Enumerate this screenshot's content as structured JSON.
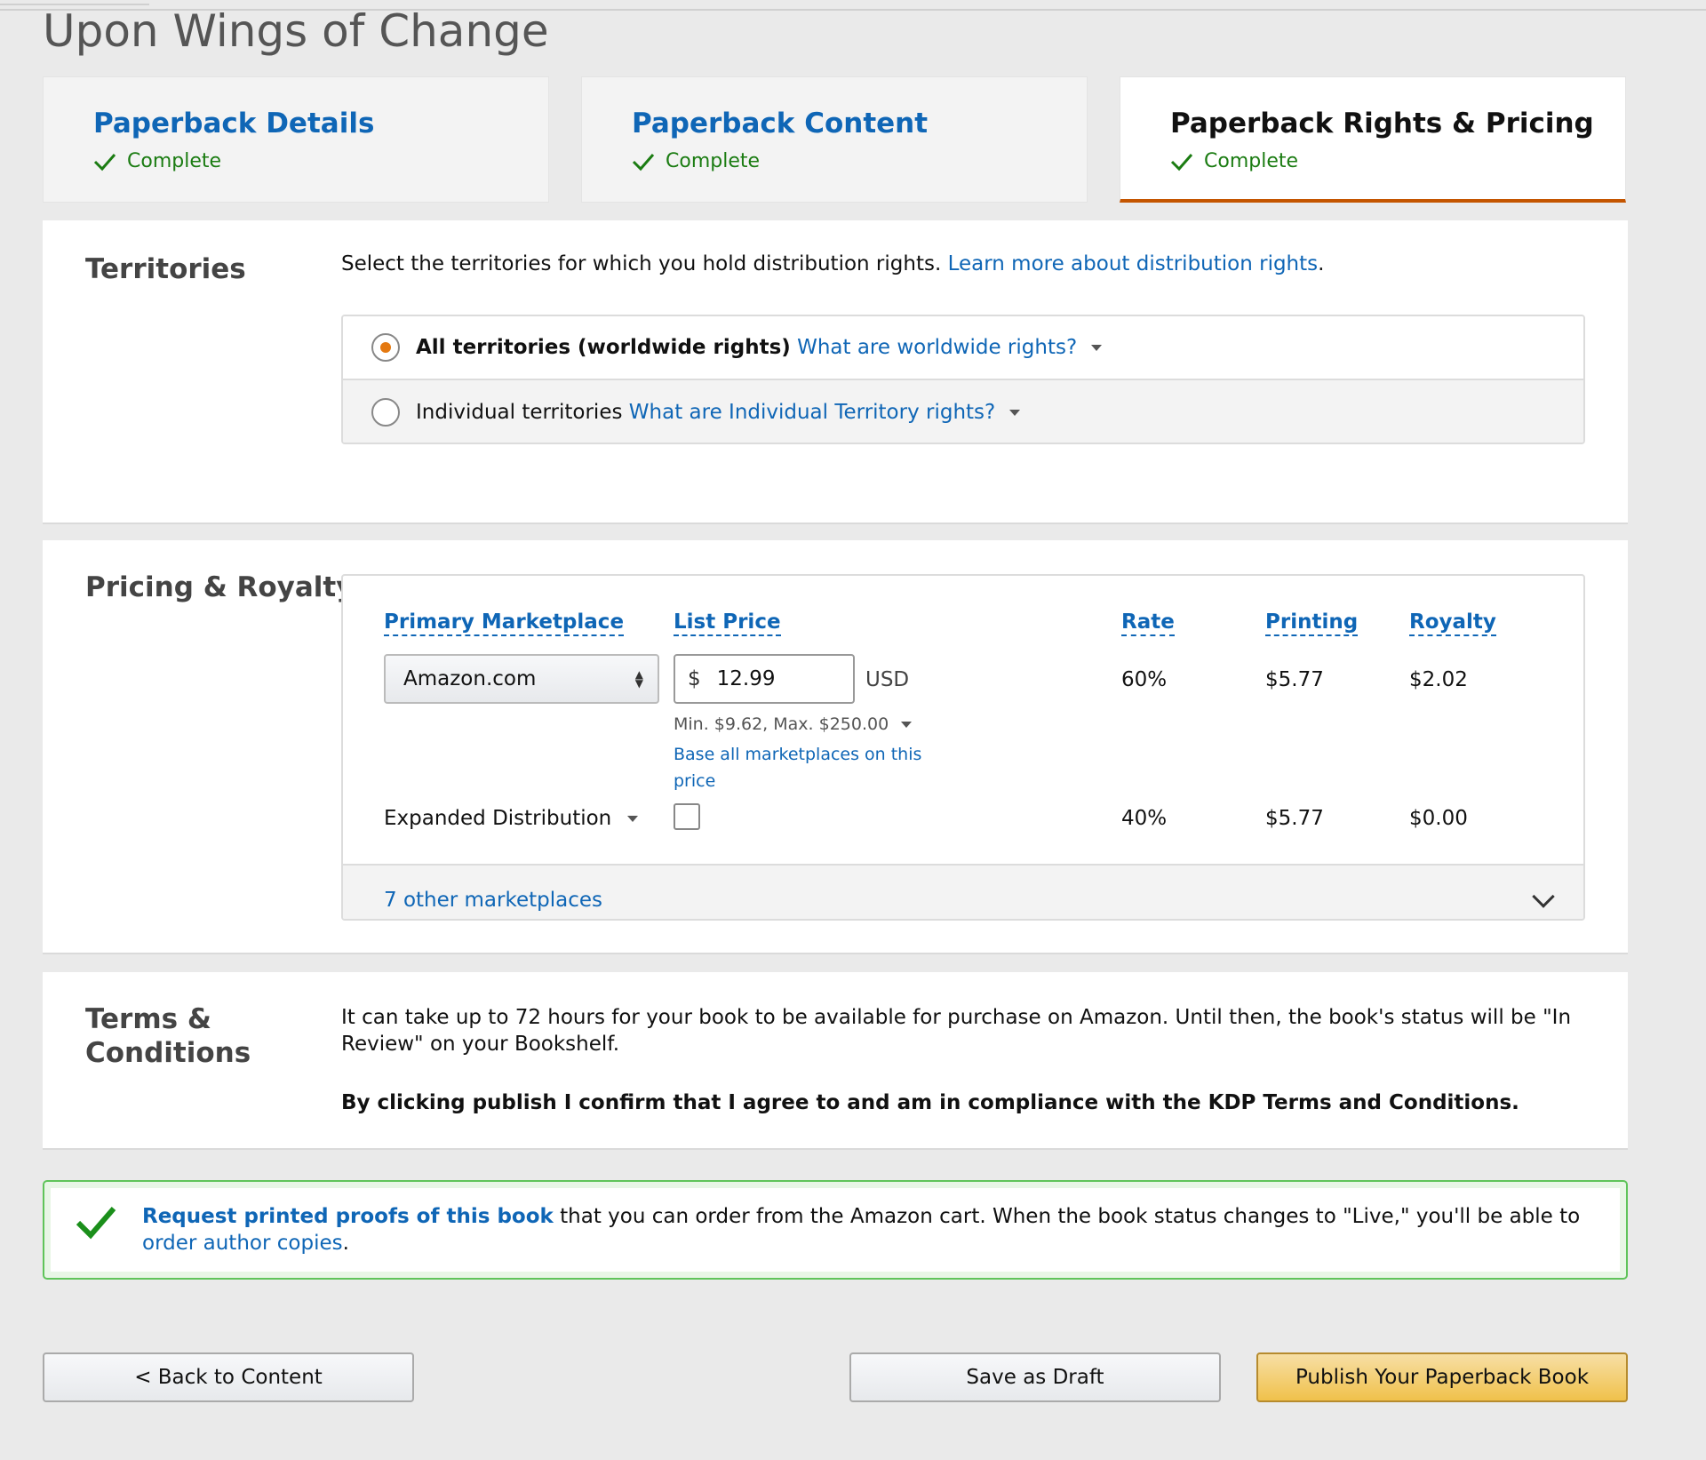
{
  "page": {
    "title": "Upon Wings of Change"
  },
  "steps": [
    {
      "label": "Paperback Details",
      "status": "Complete"
    },
    {
      "label": "Paperback Content",
      "status": "Complete"
    },
    {
      "label": "Paperback Rights & Pricing",
      "status": "Complete"
    }
  ],
  "territories": {
    "heading": "Territories",
    "intro": "Select the territories for which you hold distribution rights.",
    "learn_more": "Learn more about distribution rights",
    "options": [
      {
        "label": "All territories (worldwide rights)",
        "help": "What are worldwide rights?",
        "selected": true
      },
      {
        "label": "Individual territories",
        "help": "What are Individual Territory rights?",
        "selected": false
      }
    ]
  },
  "pricing": {
    "heading": "Pricing & Royalty",
    "columns": {
      "marketplace": "Primary Marketplace",
      "list_price": "List Price",
      "rate": "Rate",
      "printing": "Printing",
      "royalty": "Royalty"
    },
    "marketplace": "Amazon.com",
    "currency_symbol": "$",
    "price": "12.99",
    "currency": "USD",
    "primary": {
      "rate": "60%",
      "printing": "$5.77",
      "royalty": "$2.02"
    },
    "minmax": "Min. $9.62, Max. $250.00",
    "base_link": "Base all marketplaces on this price",
    "expanded": {
      "label": "Expanded Distribution",
      "checked": false,
      "rate": "40%",
      "printing": "$5.77",
      "royalty": "$0.00"
    },
    "other_marketplaces": "7 other marketplaces"
  },
  "terms": {
    "heading": "Terms & Conditions",
    "text": "It can take up to 72 hours for your book to be available for purchase on Amazon. Until then, the book's status will be \"In Review\" on your Bookshelf.",
    "confirm": "By clicking publish I confirm that I agree to and am in compliance with the KDP Terms and Conditions."
  },
  "proofs": {
    "link": "Request printed proofs of this book",
    "text": " that you can order from the Amazon cart. When the book status changes to \"Live,\" you'll be able to ",
    "order_link": "order author copies",
    "end": "."
  },
  "buttons": {
    "back": "< Back to Content",
    "draft": "Save as Draft",
    "publish": "Publish Your Paperback Book"
  },
  "colors": {
    "link": "#0f66b6",
    "success": "#1b7c12",
    "accent": "#c45500",
    "radio": "#e47911",
    "primary_button": "#f0c14b"
  }
}
